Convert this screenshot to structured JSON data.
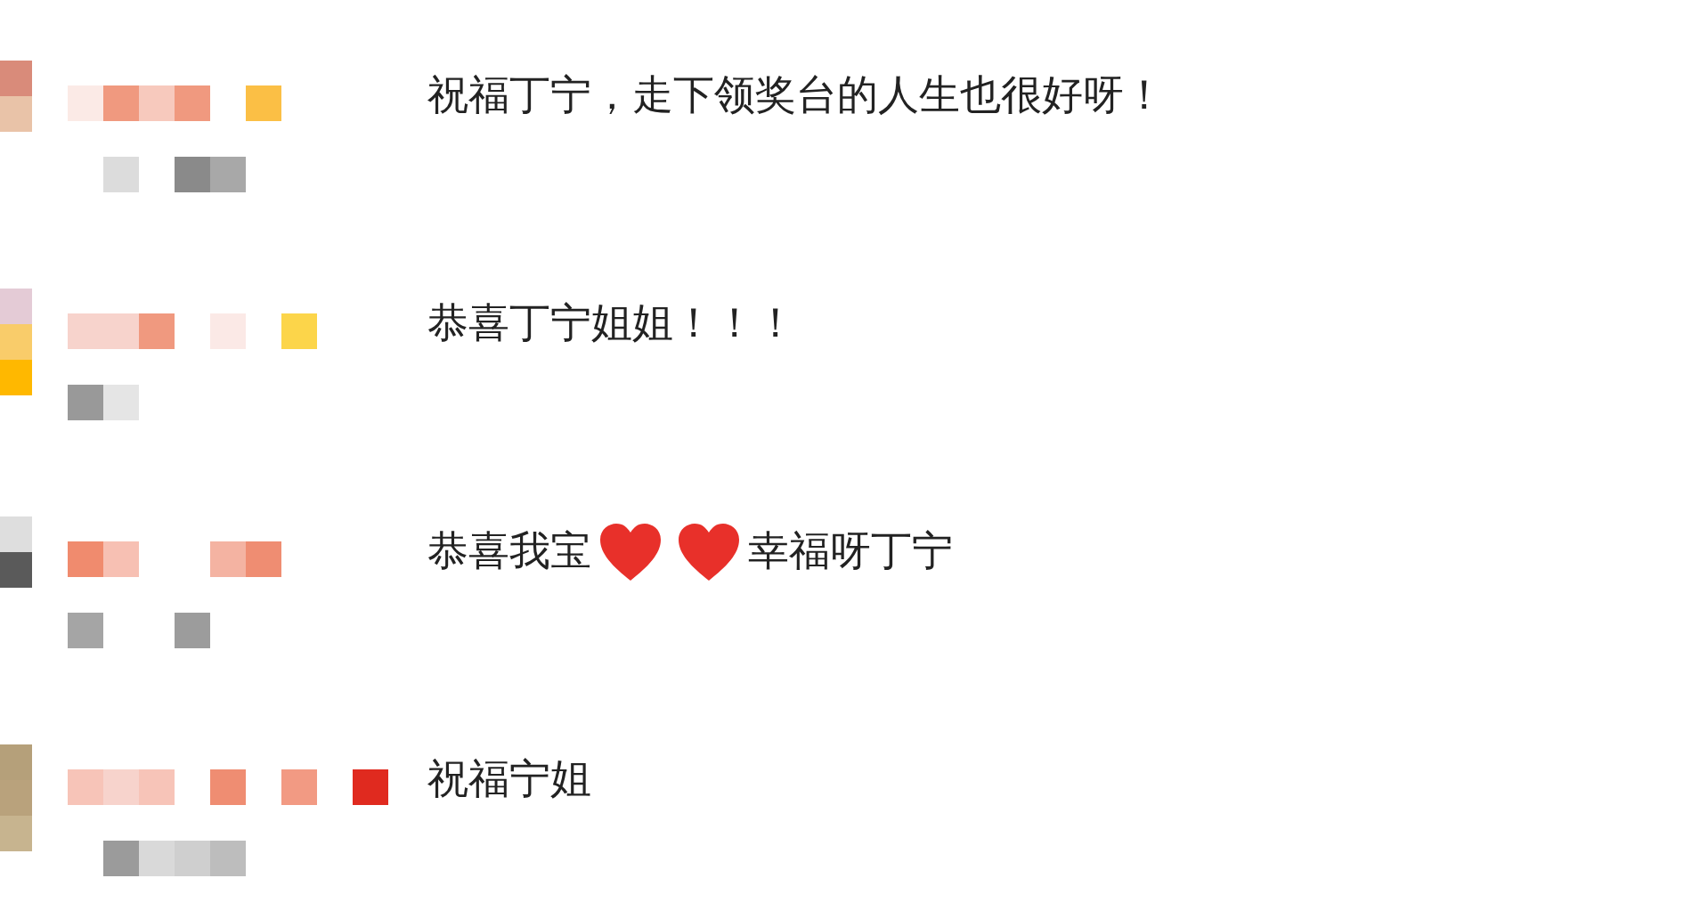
{
  "comments": [
    {
      "segments": [
        {
          "kind": "text",
          "text": "祝福丁宁，走下领奖台的人生也很好呀！"
        }
      ]
    },
    {
      "segments": [
        {
          "kind": "text",
          "text": "恭喜丁宁姐姐！！！"
        }
      ]
    },
    {
      "segments": [
        {
          "kind": "text",
          "text": "恭喜我宝"
        },
        {
          "kind": "heart"
        },
        {
          "kind": "heart"
        },
        {
          "kind": "text",
          "text": "幸福呀丁宁"
        }
      ]
    },
    {
      "segments": [
        {
          "kind": "text",
          "text": "祝福宁姐"
        }
      ]
    }
  ]
}
